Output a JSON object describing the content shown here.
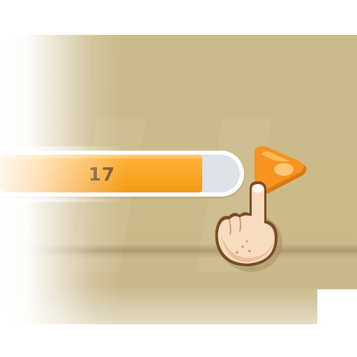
{
  "slider": {
    "value_label": "17",
    "fill_fraction": 0.85,
    "fill_color": "#f9a624",
    "track_color": "#dfe2e6"
  },
  "handle": {
    "icon": "triangle-handle-icon",
    "color": "#f7941d"
  },
  "hint": {
    "icon": "pointing-finger-icon"
  },
  "colors": {
    "background": "#cbbb8c",
    "value_text": "#6b4a1c"
  }
}
